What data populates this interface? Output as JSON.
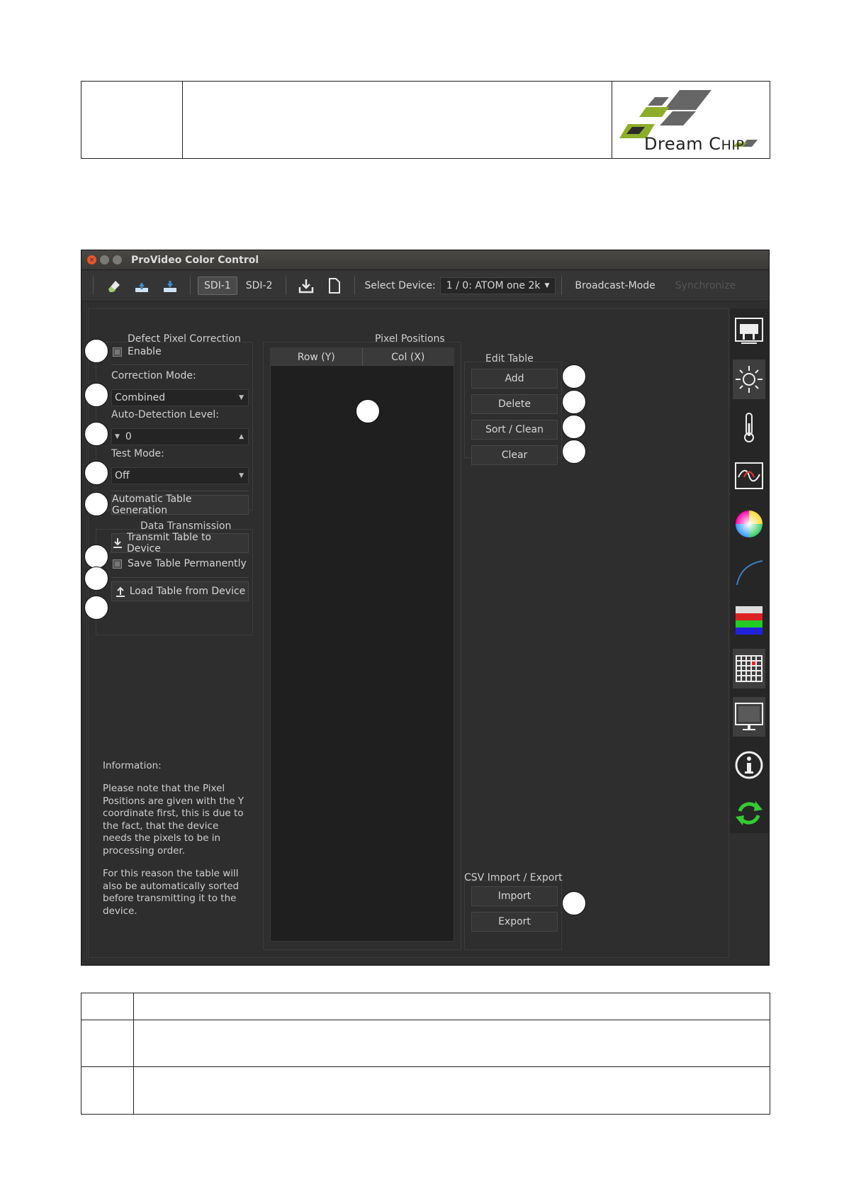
{
  "logo": {
    "text_main": "Dream C",
    "text_small": "HIP"
  },
  "window": {
    "title": "ProVideo Color Control"
  },
  "toolbar": {
    "sdi1": "SDI-1",
    "sdi2": "SDI-2",
    "select_device_label": "Select Device:",
    "select_device_value": "1 / 0: ATOM one 2k",
    "broadcast_mode": "Broadcast-Mode",
    "synchronize": "Synchronize"
  },
  "dpc": {
    "group_title": "Defect Pixel Correction",
    "enable_label": "Enable",
    "correction_mode_label": "Correction Mode:",
    "correction_mode_value": "Combined",
    "auto_detection_label": "Auto-Detection Level:",
    "auto_detection_value": "0",
    "test_mode_label": "Test Mode:",
    "test_mode_value": "Off",
    "auto_table_button": "Automatic Table Generation"
  },
  "data_transmission": {
    "group_title": "Data Transmission",
    "transmit_button": "Transmit Table to Device",
    "save_permanently_label": "Save Table Permanently",
    "load_button": "Load Table from Device"
  },
  "pixel_positions": {
    "group_title": "Pixel Positions",
    "columns": [
      "Row (Y)",
      "Col (X)"
    ]
  },
  "edit_table": {
    "group_title": "Edit Table",
    "add": "Add",
    "delete": "Delete",
    "sort_clean": "Sort / Clean",
    "clear": "Clear"
  },
  "csv": {
    "group_title": "CSV Import / Export",
    "import": "Import",
    "export": "Export"
  },
  "information": {
    "title": "Information:",
    "para1": "Please note that the Pixel Positions are given with the Y coordinate first, this is due to the fact, that the device needs the pixels to be in processing order.",
    "para2": "For this reason the table will also be automatically sorted before transmitting it to the device."
  },
  "sidebar_icons": [
    "camera-icon",
    "brightness-icon",
    "thermometer-icon",
    "waveform-icon",
    "color-wheel-icon",
    "curve-icon",
    "rgb-bars-icon",
    "dpc-grid-icon",
    "monitor-icon",
    "info-icon",
    "refresh-icon"
  ]
}
